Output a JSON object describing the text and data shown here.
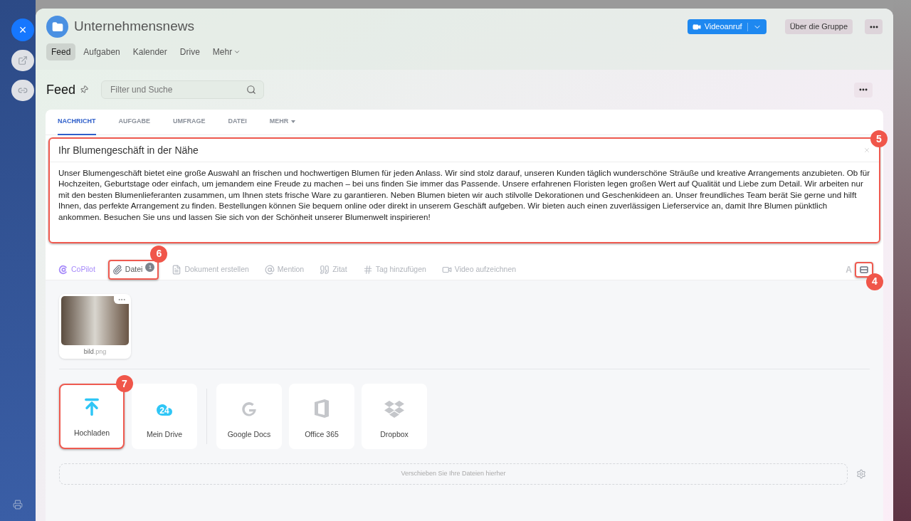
{
  "rail": {
    "close_icon": "×"
  },
  "group": {
    "title": "Unternehmensnews",
    "nav": [
      {
        "label": "Feed",
        "selected": true
      },
      {
        "label": "Aufgaben",
        "selected": false
      },
      {
        "label": "Kalender",
        "selected": false
      },
      {
        "label": "Drive",
        "selected": false
      },
      {
        "label": "Mehr",
        "selected": false,
        "dropdown": true
      }
    ],
    "video_button": "Videoanruf",
    "about_button": "Über die Gruppe"
  },
  "feed": {
    "title": "Feed",
    "search": {
      "placeholder": "Filter und Suche"
    }
  },
  "composer": {
    "tabs": [
      {
        "label": "NACHRICHT",
        "selected": true
      },
      {
        "label": "AUFGABE",
        "selected": false
      },
      {
        "label": "UMFRAGE",
        "selected": false
      },
      {
        "label": "DATEI",
        "selected": false
      },
      {
        "label": "MEHR",
        "selected": false,
        "dropdown": true
      }
    ],
    "subject": "Ihr Blumengeschäft in der Nähe",
    "subject_callout": "5",
    "body": "Unser Blumengeschäft bietet eine große Auswahl an frischen und hochwertigen Blumen für jeden Anlass. Wir sind stolz darauf, unseren Kunden täglich wunderschöne Sträuße und kreative Arrangements anzubieten. Ob für Hochzeiten, Geburtstage oder einfach, um jemandem eine Freude zu machen – bei uns finden Sie immer das Passende. Unsere erfahrenen Floristen legen großen Wert auf Qualität und Liebe zum Detail. Wir arbeiten nur mit den besten Blumenlieferanten zusammen, um Ihnen stets frische Ware zu garantieren. Neben Blumen bieten wir auch stilvolle Dekorationen und Geschenkideen an. Unser freundliches Team berät Sie gerne und hilft Ihnen, das perfekte Arrangement zu finden. Bestellungen können Sie bequem online oder direkt in unserem Geschäft aufgeben. Wir bieten auch einen zuverlässigen Lieferservice an, damit Ihre Blumen pünktlich ankommen. Besuchen Sie uns und lassen Sie sich von der Schönheit unserer Blumenwelt inspirieren!",
    "toolbar": [
      {
        "kind": "copilot",
        "label": "CoPilot"
      },
      {
        "kind": "file",
        "label": "Datei",
        "count": "1",
        "callout": "6"
      },
      {
        "kind": "document",
        "label": "Dokument erstellen"
      },
      {
        "kind": "mention",
        "label": "Mention"
      },
      {
        "kind": "quote",
        "label": "Zitat"
      },
      {
        "kind": "tag",
        "label": "Tag hinzufügen"
      },
      {
        "kind": "video",
        "label": "Video aufzeichnen"
      }
    ],
    "format_letter": "A",
    "editor_toggle_callout": "4",
    "attachment": {
      "name": "bild",
      "ext": ".png"
    },
    "sources": [
      {
        "kind": "upload",
        "label": "Hochladen",
        "callout": "7"
      },
      {
        "kind": "drive",
        "label": "Mein Drive",
        "badge": "24"
      },
      {
        "kind": "google",
        "label": "Google Docs"
      },
      {
        "kind": "office",
        "label": "Office 365"
      },
      {
        "kind": "dropbox",
        "label": "Dropbox"
      }
    ],
    "dropzone": "Verschieben Sie Ihre Dateien hierher"
  }
}
